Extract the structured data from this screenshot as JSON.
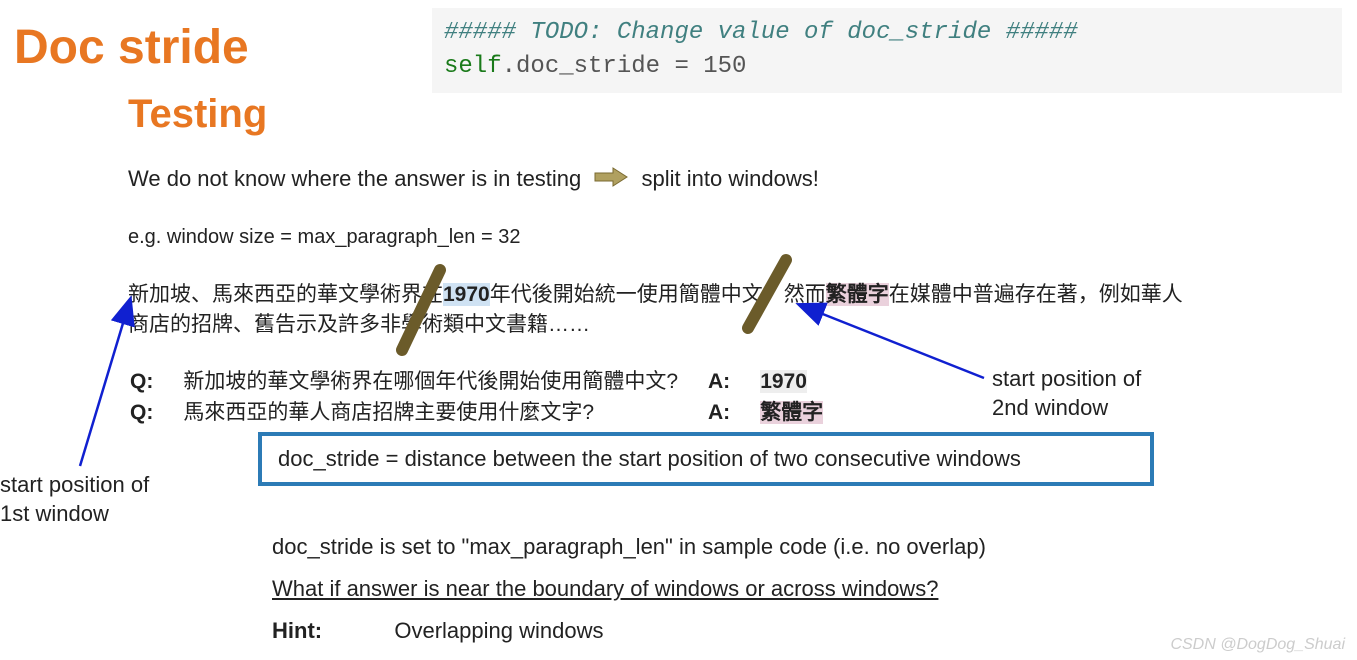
{
  "title_main": "Doc stride",
  "title_sub": "Testing",
  "code": {
    "comment": "##### TODO: Change value of doc_stride #####",
    "line": "self.doc_stride = 150",
    "self_token": "self",
    "rest": ".doc_stride = ",
    "value": "150"
  },
  "line1_pre": "We do not know where the answer is in testing",
  "line1_post": "split into windows!",
  "line2": "e.g.    window size = max_paragraph_len = 32",
  "paragraph": {
    "pre1": "新加坡、馬來西亞的華文學術界在",
    "hl_year": "1970",
    "mid1": "年代後開始統一使用簡體中文，然而",
    "hl_word": "繁體字",
    "post1": "在媒體中普遍存在著，例如華人商店的招牌、舊告示及許多非學術類中文書籍……"
  },
  "qa": {
    "q_label": "Q:",
    "a_label": "A:",
    "q1": "新加坡的華文學術界在哪個年代後開始使用簡體中文?",
    "a1": "1970",
    "q2": "馬來西亞的華人商店招牌主要使用什麼文字?",
    "a2": "繁體字"
  },
  "definition": "doc_stride = distance between the start position of two consecutive windows",
  "note1": "doc_stride is set to \"max_paragraph_len\" in sample code (i.e. no overlap)",
  "note2": "What if answer is near the boundary of windows or across windows?",
  "hint_label": "Hint:",
  "hint_text": "Overlapping windows",
  "label_left": "start position of\n1st window",
  "label_right": "start position of\n2nd window",
  "watermark": "CSDN @DogDog_Shuai"
}
